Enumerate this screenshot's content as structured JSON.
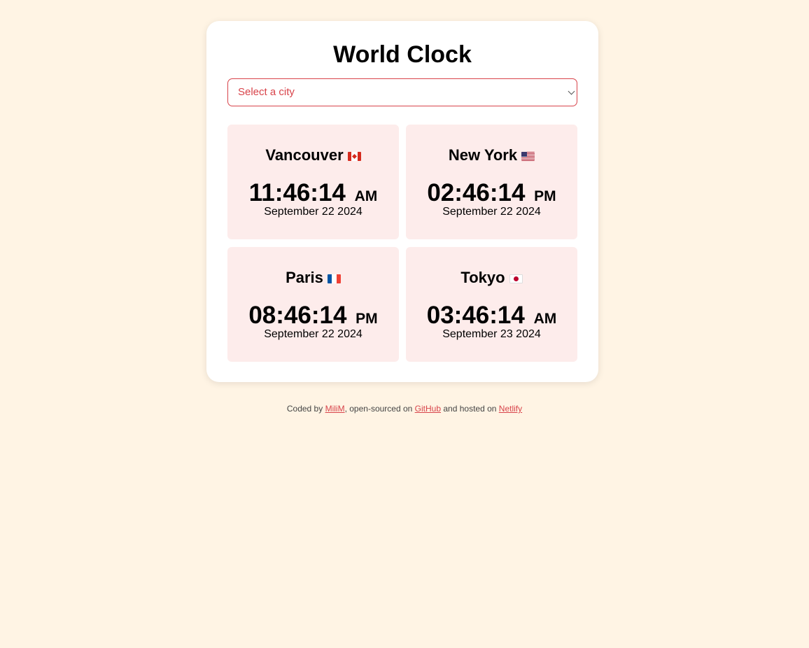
{
  "app": {
    "title": "World Clock"
  },
  "city_select": {
    "placeholder": "Select a city"
  },
  "cities": [
    {
      "name": "Vancouver",
      "flag_icon": "canada-flag-icon",
      "time": "11:46:14",
      "period": "AM",
      "date": "September 22 2024"
    },
    {
      "name": "New York",
      "flag_icon": "usa-flag-icon",
      "time": "02:46:14",
      "period": "PM",
      "date": "September 22 2024"
    },
    {
      "name": "Paris",
      "flag_icon": "france-flag-icon",
      "time": "08:46:14",
      "period": "PM",
      "date": "September 22 2024"
    },
    {
      "name": "Tokyo",
      "flag_icon": "japan-flag-icon",
      "time": "03:46:14",
      "period": "AM",
      "date": "September 23 2024"
    }
  ],
  "footer": {
    "prefix": "Coded by",
    "author_link": "MiliM",
    "middle": ", open-sourced on",
    "github_link": "GitHub",
    "hosted": "and hosted on",
    "netlify_link": "Netlify"
  },
  "colors": {
    "page_background": "#fff4e4",
    "card_background": "#ffffff",
    "city_card_background": "#fdeceb",
    "accent": "#d8434a"
  }
}
